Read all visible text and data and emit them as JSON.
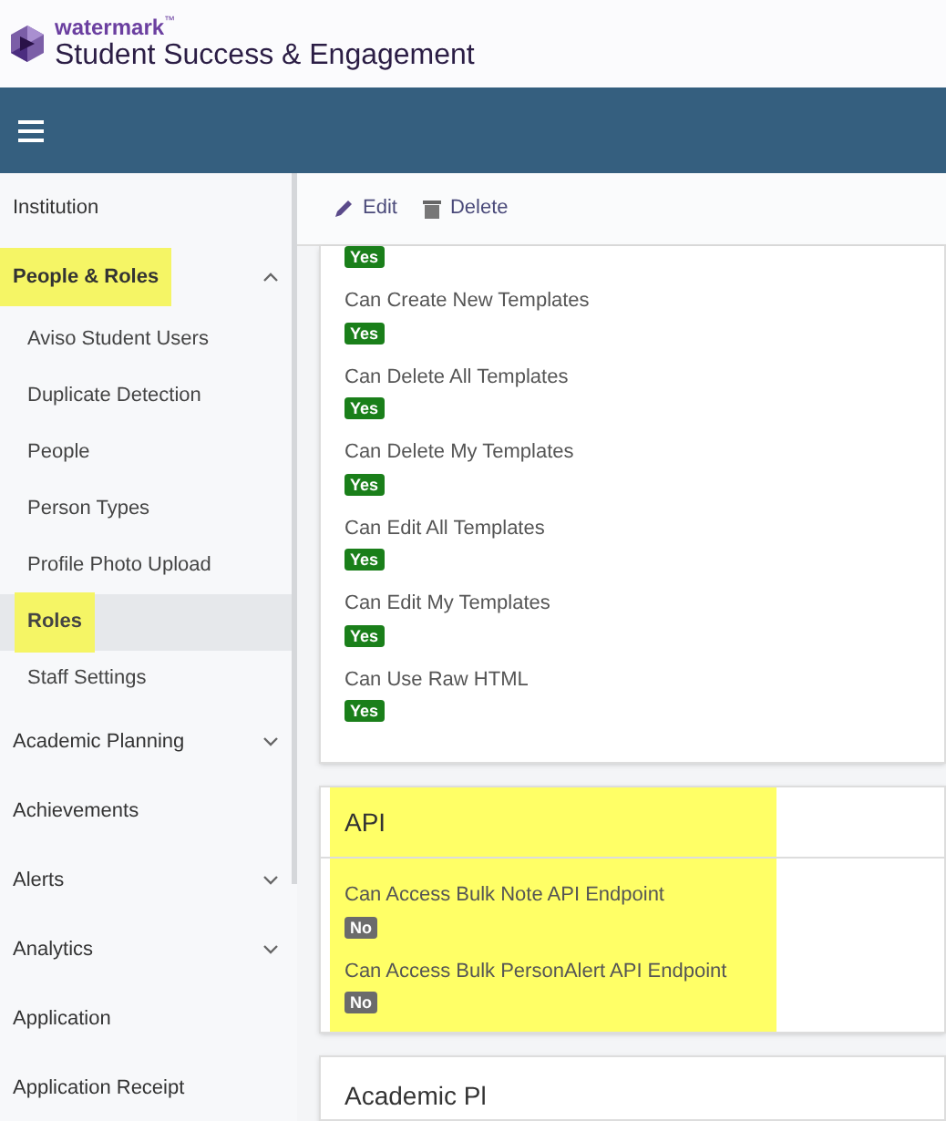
{
  "brand": {
    "wordmark": "watermark",
    "trademark": "™",
    "product": "Student Success & Engagement"
  },
  "sidebar": {
    "items": [
      {
        "label": "Institution",
        "kind": "link",
        "selected": false,
        "highlighted": false
      },
      {
        "label": "People & Roles",
        "kind": "group",
        "expanded": true,
        "selected": false,
        "highlighted": true,
        "children": [
          {
            "label": "Aviso Student Users",
            "selected": false,
            "highlighted": false
          },
          {
            "label": "Duplicate Detection",
            "selected": false,
            "highlighted": false
          },
          {
            "label": "People",
            "selected": false,
            "highlighted": false
          },
          {
            "label": "Person Types",
            "selected": false,
            "highlighted": false
          },
          {
            "label": "Profile Photo Upload",
            "selected": false,
            "highlighted": false
          },
          {
            "label": "Roles",
            "selected": true,
            "highlighted": true
          },
          {
            "label": "Staff Settings",
            "selected": false,
            "highlighted": false
          }
        ]
      },
      {
        "label": "Academic Planning",
        "kind": "group",
        "expanded": false,
        "selected": false,
        "highlighted": false
      },
      {
        "label": "Achievements",
        "kind": "link",
        "selected": false,
        "highlighted": false
      },
      {
        "label": "Alerts",
        "kind": "group",
        "expanded": false,
        "selected": false,
        "highlighted": false
      },
      {
        "label": "Analytics",
        "kind": "group",
        "expanded": false,
        "selected": false,
        "highlighted": false
      },
      {
        "label": "Application",
        "kind": "link",
        "selected": false,
        "highlighted": false
      },
      {
        "label": "Application Receipt",
        "kind": "link",
        "selected": false,
        "highlighted": false
      }
    ]
  },
  "toolbar": {
    "buttons": [
      {
        "label": "Edit",
        "kind": "edit"
      },
      {
        "label": "Delete",
        "kind": "delete"
      }
    ]
  },
  "cards": [
    {
      "highlighted": false,
      "permissions": [
        {
          "value": "Yes",
          "granted": true
        },
        {
          "label": "Can Create New Templates",
          "value": "Yes",
          "granted": true
        },
        {
          "label": "Can Delete All Templates",
          "value": "Yes",
          "granted": true
        },
        {
          "label": "Can Delete My Templates",
          "value": "Yes",
          "granted": true
        },
        {
          "label": "Can Edit All Templates",
          "value": "Yes",
          "granted": true
        },
        {
          "label": "Can Edit My Templates",
          "value": "Yes",
          "granted": true
        },
        {
          "label": "Can Use Raw HTML",
          "value": "Yes",
          "granted": true
        }
      ]
    },
    {
      "title": "API",
      "highlighted": true,
      "permissions": [
        {
          "label": "Can Access Bulk Note API Endpoint",
          "value": "No",
          "granted": false
        },
        {
          "label": "Can Access Bulk PersonAlert API Endpoint",
          "value": "No",
          "granted": false
        }
      ]
    },
    {
      "title": "Academic Pl",
      "highlighted": false
    }
  ]
}
